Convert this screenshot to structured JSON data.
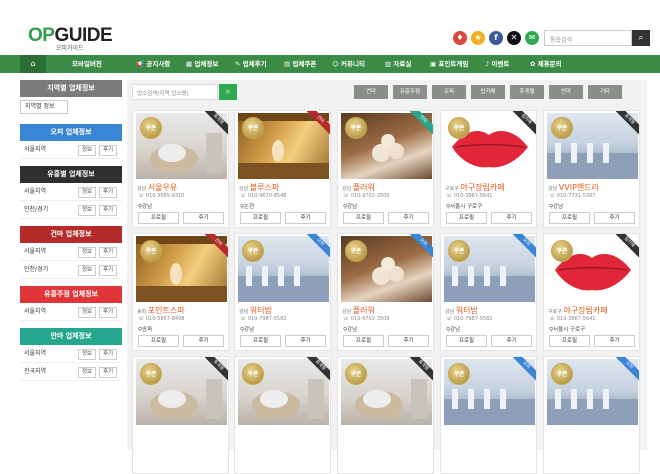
{
  "header": {
    "logo_op": "OP",
    "logo_guide": "GUIDE",
    "logo_sub": "오피가이드",
    "search_placeholder": "통합검색"
  },
  "nav": {
    "items": [
      "모바일버전",
      "공지사항",
      "업체정보",
      "업체후기",
      "업체쿠폰",
      "커뮤니티",
      "자료실",
      "포인트게임",
      "이벤트",
      "제휴문의"
    ]
  },
  "sidebar": {
    "sections": [
      {
        "title": "지역별 업체정보",
        "color": "#7b7b7b",
        "rows": [
          {
            "label": "지역별 정보",
            "btns": []
          }
        ]
      },
      {
        "title": "오피 업체정보",
        "color": "#3a86d6",
        "rows": [
          {
            "label": "서울지역",
            "btns": [
              "정보",
              "후기"
            ]
          }
        ]
      },
      {
        "title": "유흥별 업체정보",
        "color": "#2f2f2f",
        "rows": [
          {
            "label": "서울지역",
            "btns": [
              "정보",
              "후기"
            ]
          },
          {
            "label": "인천/경기",
            "btns": [
              "정보",
              "후기"
            ]
          }
        ]
      },
      {
        "title": "건마 업체정보",
        "color": "#b52a2a",
        "rows": [
          {
            "label": "서울지역",
            "btns": [
              "정보",
              "후기"
            ]
          },
          {
            "label": "인천/경기",
            "btns": [
              "정보",
              "후기"
            ]
          }
        ]
      },
      {
        "title": "유흥주점 업체정보",
        "color": "#e0363a",
        "rows": [
          {
            "label": "서울지역",
            "btns": [
              "정보",
              "후기"
            ]
          }
        ]
      },
      {
        "title": "안마 업체정보",
        "color": "#26a68e",
        "rows": [
          {
            "label": "서울지역",
            "btns": [
              "정보",
              "후기"
            ]
          },
          {
            "label": "전국지역",
            "btns": [
              "정보",
              "후기"
            ]
          }
        ]
      }
    ]
  },
  "filter": {
    "placeholder": "업소검색(지역,업소명)",
    "categories": [
      "건마",
      "유흥주점",
      "오피",
      "립카페",
      "휴게텔",
      "안마",
      "기타"
    ]
  },
  "cards": [
    {
      "theme": "lounge",
      "tag": "휴게텔",
      "tag_color": "#333333",
      "region": "강남",
      "name": "서울우유",
      "phone": "010-3585-9310",
      "loc": "강남"
    },
    {
      "theme": "sauna",
      "tag": "건마",
      "tag_color": "#b52a2a",
      "region": "강남",
      "name": "블루스파",
      "phone": "010-9670-8548",
      "loc": "논현"
    },
    {
      "theme": "spa",
      "tag": "안마",
      "tag_color": "#26a68e",
      "region": "강남",
      "name": "플러워",
      "phone": "010-9702-3509",
      "loc": "강남"
    },
    {
      "theme": "lips",
      "tag": "립카페",
      "tag_color": "#333333",
      "region": "구로구",
      "name": "야구장립카페",
      "phone": "010-3867-5641",
      "loc": "서울시 구로구"
    },
    {
      "theme": "hall",
      "tag": "휴게텔",
      "tag_color": "#333333",
      "region": "강남",
      "name": "VVIP핸드라",
      "phone": "010-7731-5387",
      "loc": "강남"
    },
    {
      "theme": "sauna",
      "tag": "건마",
      "tag_color": "#b52a2a",
      "region": "송파",
      "name": "포인트스파",
      "phone": "010-5957-8498",
      "loc": "송파"
    },
    {
      "theme": "hall",
      "tag": "오피",
      "tag_color": "#3a86d6",
      "region": "강남",
      "name": "워터밤",
      "phone": "010-7987-5582",
      "loc": "강남"
    },
    {
      "theme": "spa",
      "tag": "오피",
      "tag_color": "#3a86d6",
      "region": "강남",
      "name": "플러워",
      "phone": "010-9702-3509",
      "loc": "강남"
    },
    {
      "theme": "hall",
      "tag": "오피",
      "tag_color": "#3a86d6",
      "region": "강남",
      "name": "워터밤",
      "phone": "010-7987-5582",
      "loc": "강남"
    },
    {
      "theme": "lips",
      "tag": "립카페",
      "tag_color": "#333333",
      "region": "구로구",
      "name": "야구장립카페",
      "phone": "010-3867-5641",
      "loc": "서울시 구로구"
    },
    {
      "theme": "lounge",
      "tag": "휴게텔",
      "tag_color": "#333333"
    },
    {
      "theme": "lounge",
      "tag": "휴게텔",
      "tag_color": "#333333"
    },
    {
      "theme": "lounge",
      "tag": "휴게텔",
      "tag_color": "#333333"
    },
    {
      "theme": "hall",
      "tag": "오피",
      "tag_color": "#3a86d6"
    },
    {
      "theme": "hall",
      "tag": "오피",
      "tag_color": "#3a86d6"
    }
  ],
  "labels": {
    "coupon": "쿠폰",
    "profile": "프로필",
    "review": "후기"
  },
  "icons": [
    "home-icon",
    "search-icon",
    "bookmark-icon",
    "star-icon",
    "facebook-icon",
    "x-icon",
    "mail-icon",
    "location-icon",
    "phone-icon"
  ]
}
